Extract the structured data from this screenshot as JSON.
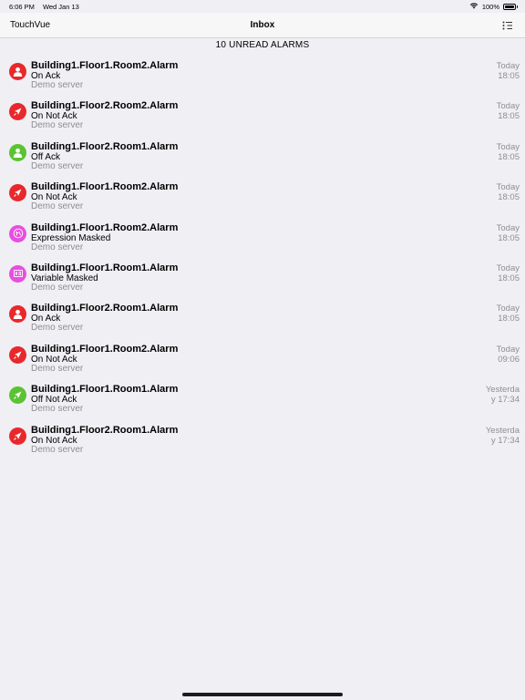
{
  "status_bar": {
    "time": "6:06 PM",
    "date": "Wed Jan 13",
    "battery": "100%",
    "battery_level": 1.0
  },
  "nav": {
    "left_label": "TouchVue",
    "title": "Inbox",
    "right_icon": "list-filter-icon"
  },
  "section_header": "10 UNREAD ALARMS",
  "colors": {
    "red": "#e8282b",
    "green": "#5ac333",
    "magenta": "#e84ee0",
    "grey_text": "#8e8e93"
  },
  "alarms": [
    {
      "name": "Building1.Floor1.Room2.Alarm",
      "state": "On Ack",
      "server": "Demo server",
      "day": "Today",
      "time": "18:05",
      "icon": "person-icon",
      "color": "#e8282b"
    },
    {
      "name": "Building1.Floor2.Room2.Alarm",
      "state": "On Not Ack",
      "server": "Demo server",
      "day": "Today",
      "time": "18:05",
      "icon": "bell-icon",
      "color": "#e8282b"
    },
    {
      "name": "Building1.Floor2.Room1.Alarm",
      "state": "Off Ack",
      "server": "Demo server",
      "day": "Today",
      "time": "18:05",
      "icon": "person-icon",
      "color": "#5ac333"
    },
    {
      "name": "Building1.Floor1.Room2.Alarm",
      "state": "On Not Ack",
      "server": "Demo server",
      "day": "Today",
      "time": "18:05",
      "icon": "bell-icon",
      "color": "#e8282b"
    },
    {
      "name": "Building1.Floor1.Room2.Alarm",
      "state": "Expression Masked",
      "server": "Demo server",
      "day": "Today",
      "time": "18:05",
      "icon": "expression-icon",
      "color": "#e84ee0"
    },
    {
      "name": "Building1.Floor1.Room1.Alarm",
      "state": "Variable Masked",
      "server": "Demo server",
      "day": "Today",
      "time": "18:05",
      "icon": "variable-icon",
      "color": "#e84ee0"
    },
    {
      "name": "Building1.Floor2.Room1.Alarm",
      "state": "On Ack",
      "server": "Demo server",
      "day": "Today",
      "time": "18:05",
      "icon": "person-icon",
      "color": "#e8282b"
    },
    {
      "name": "Building1.Floor1.Room2.Alarm",
      "state": "On Not Ack",
      "server": "Demo server",
      "day": "Today",
      "time": "09:06",
      "icon": "bell-icon",
      "color": "#e8282b"
    },
    {
      "name": "Building1.Floor1.Room1.Alarm",
      "state": "Off Not Ack",
      "server": "Demo server",
      "day": "Yesterda",
      "time": "y 17:34",
      "icon": "bell-icon",
      "color": "#5ac333"
    },
    {
      "name": "Building1.Floor2.Room1.Alarm",
      "state": "On Not Ack",
      "server": "Demo server",
      "day": "Yesterda",
      "time": "y 17:34",
      "icon": "bell-icon",
      "color": "#e8282b"
    }
  ]
}
